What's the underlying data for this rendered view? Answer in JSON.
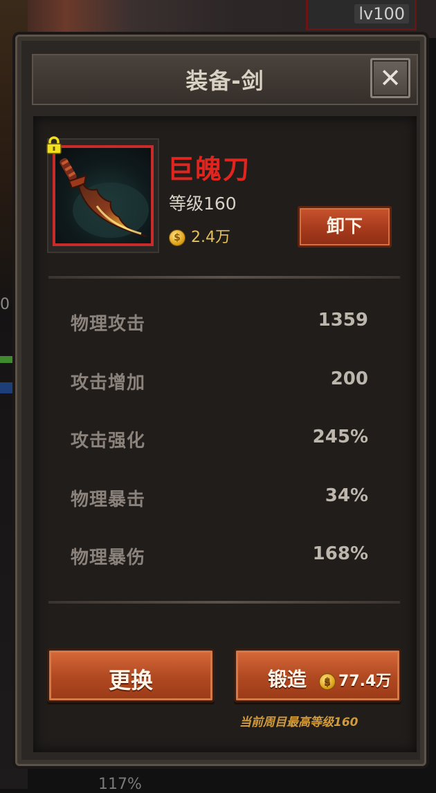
{
  "background": {
    "level_badge": "lv100",
    "side_number": "0",
    "bottom_text": "117%"
  },
  "dialog": {
    "title": "装备-剑",
    "close_icon": "close-icon"
  },
  "item": {
    "name": "巨魄刀",
    "level_text": "等级160",
    "price": "2.4万",
    "name_color": "#e0241e",
    "frame_color": "#c92a2a",
    "locked_icon": "lock-icon",
    "unequip_label": "卸下"
  },
  "stats": [
    {
      "label": "物理攻击",
      "value": "1359"
    },
    {
      "label": "攻击增加",
      "value": "200"
    },
    {
      "label": "攻击强化",
      "value": "245%"
    },
    {
      "label": "物理暴击",
      "value": "34%"
    },
    {
      "label": "物理暴伤",
      "value": "168%"
    }
  ],
  "actions": {
    "replace_label": "更换",
    "forge_label": "锻造",
    "forge_cost": "77.4万",
    "coin_symbol": "$"
  },
  "hint": "当前周目最高等级160"
}
